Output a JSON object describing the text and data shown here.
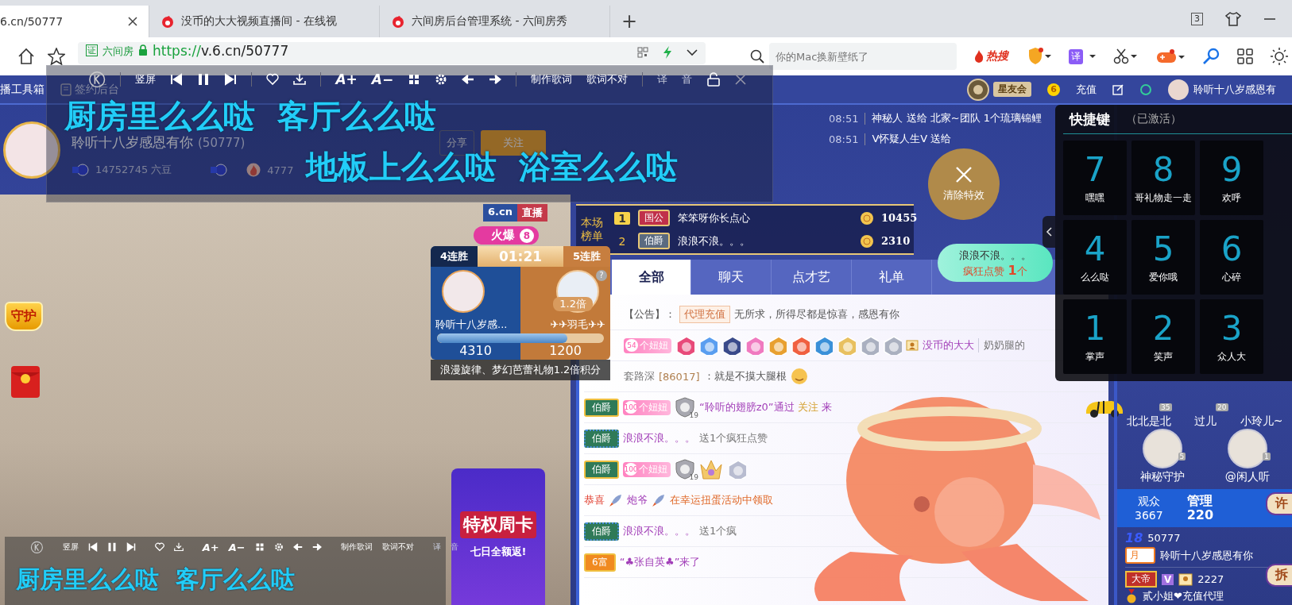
{
  "browser": {
    "tabs": [
      {
        "title": "6.cn/50777",
        "selected": true,
        "favicon": false
      },
      {
        "title": "没币的大大视频直播间 - 在线视",
        "selected": false,
        "favicon": true
      },
      {
        "title": "六间房后台管理系统 - 六间房秀",
        "selected": false,
        "favicon": true
      }
    ],
    "new_tab": "+",
    "tab_count": "3",
    "address": {
      "cert": "证",
      "site": "六间房",
      "scheme": "https://",
      "rest": "v.6.cn/50777"
    },
    "search": {
      "placeholder": "你的Mac换新壁纸了",
      "hot": "热搜"
    },
    "translate": "译"
  },
  "header": {
    "tools": [
      "播工具箱",
      "签约后台"
    ],
    "club": "星友会",
    "coin": "6",
    "recharge": "充值",
    "user": "聆听十八岁感恩有"
  },
  "streamer": {
    "name": "聆听十八岁感恩有你",
    "id": "(50777)",
    "beans": "14752745 六豆",
    "heat": "4777",
    "share": "分享",
    "follow": "关注"
  },
  "lyrics_window": {
    "rotate": "竖屏",
    "font_up": "A+",
    "font_down": "A−",
    "make": "制作歌词",
    "wrong": "歌词不对",
    "translate": "译",
    "sound": "音",
    "lines": [
      "厨房里么么哒  客厅么么哒",
      "地板上么么哒  浴室么么哒"
    ]
  },
  "gift_feed": [
    {
      "time": "08:51",
      "text": "神秘人 送给 北家~团队 1个琉璃锦鲤"
    },
    {
      "time": "08:51",
      "text": "V怀疑人生V 送给"
    }
  ],
  "video": {
    "site": "6.cn",
    "live": "直播",
    "hot": {
      "label": "火爆",
      "count": "8"
    },
    "guard": "守护",
    "promo": {
      "title": "特权周卡",
      "subtitle": "七日全额返!"
    },
    "lyrics_bar": {
      "rotate": "竖屏",
      "font_up": "A+",
      "font_down": "A−",
      "make": "制作歌词",
      "wrong": "歌词不对",
      "translate": "译",
      "sound": "音",
      "line": "厨房里么么哒  客厅么么哒"
    }
  },
  "pk": {
    "left_streak": "4连胜",
    "timer": "01:21",
    "right_streak": "5连胜",
    "help": "?",
    "multiplier": "1.2倍",
    "left_name": "聆听十八岁感...",
    "right_name": "✈✈羽毛✈✈",
    "level": 0.78,
    "left_score": "4310",
    "right_score": "1200",
    "note": "浪漫旋律、梦幻芭蕾礼物1.2倍积分"
  },
  "clear_effects": "清除特效",
  "ranking": {
    "title": "本场榜单",
    "rows": [
      {
        "rank": "1",
        "boxed": true,
        "title": "国公",
        "name": "笨笨呀你长点心",
        "score": "10455"
      },
      {
        "rank": "2",
        "boxed": false,
        "title": "伯爵",
        "name": "浪浪不浪。。。",
        "score": "2310"
      }
    ]
  },
  "like_bubble": {
    "name": "浪浪不浪。。。",
    "text": "疯狂点赞 **1**个"
  },
  "chat": {
    "tabs": [
      {
        "label": "全部",
        "selected": true
      },
      {
        "label": "聊天",
        "selected": false
      },
      {
        "label": "点才艺",
        "selected": false
      },
      {
        "label": "礼单",
        "selected": false
      }
    ],
    "messages": [
      {
        "kind": "notice",
        "label": "【公告】：",
        "tag": "代理充值",
        "text": "无所求，所得尽都是惊喜，感恩有你"
      },
      {
        "kind": "medals",
        "fan_level": "54",
        "fan_label": "个妞妞",
        "name": "没币的大大",
        "extra": "奶奶腿的"
      },
      {
        "kind": "chat",
        "name": "套路深",
        "uid": "[86017]",
        "text": "：就是不摸大腿根"
      },
      {
        "kind": "follow",
        "color": "#2f7a58",
        "dotted": false,
        "rank": "伯爵",
        "fan_level": "100",
        "fan_label": "个妞妞",
        "guard": "19",
        "before": "“聆听的翅膀z0”通过 ",
        "link": "关注",
        "after": " 来"
      },
      {
        "kind": "action",
        "color": "#2f7a58",
        "dotted": true,
        "rank": "伯爵",
        "name": "浪浪不浪。。。",
        "text": "送1个疯狂点赞"
      },
      {
        "kind": "welcome",
        "color": "#2f7a58",
        "dotted": false,
        "rank": "伯爵",
        "fan_level": "100",
        "fan_label": "个妞妞",
        "guard": "19"
      },
      {
        "kind": "system",
        "lead": "恭喜",
        "name": "炮爷",
        "text": "在幸运扭蛋活动中领取"
      },
      {
        "kind": "action",
        "color": "#2f7a58",
        "dotted": true,
        "rank": "伯爵",
        "name": "浪浪不浪。。。",
        "text": "送1个疯"
      },
      {
        "kind": "enter",
        "color": "#f08a20",
        "dotted": false,
        "rank": "6富",
        "text": "“♣张自英♣”来了"
      }
    ]
  },
  "shortcuts": {
    "title": "快捷键",
    "status": "（已激活）",
    "keys": [
      {
        "key": "7",
        "label": "嘿嘿"
      },
      {
        "key": "8",
        "label": "哥礼物走一走"
      },
      {
        "key": "9",
        "label": "欢呼"
      },
      {
        "key": "4",
        "label": "么么哒"
      },
      {
        "key": "5",
        "label": "爱你哦"
      },
      {
        "key": "6",
        "label": "心碎"
      },
      {
        "key": "1",
        "label": "掌声"
      },
      {
        "key": "2",
        "label": "笑声"
      },
      {
        "key": "3",
        "label": "众人大"
      }
    ]
  },
  "guards": {
    "rows": [
      {
        "show_avatars": false,
        "items": [
          {
            "name": "北北是北",
            "level": "35"
          },
          {
            "name": "过儿",
            "level": "20"
          },
          {
            "name": "小玲儿~"
          }
        ]
      },
      {
        "show_avatars": true,
        "items": [
          {
            "name": "神秘守护",
            "level": "5"
          },
          {
            "name": "@闲人听",
            "level": "1"
          }
        ]
      }
    ]
  },
  "stats": [
    {
      "label": "观众",
      "value": "3667",
      "selected": false
    },
    {
      "label": "管理",
      "value": "220",
      "selected": true
    }
  ],
  "side_buttons": [
    "许",
    "拆"
  ],
  "fans": [
    {
      "kind": "anchor",
      "level": "18",
      "number": "50777",
      "badge": "月",
      "name": "聆听十八岁感恩有你"
    },
    {
      "kind": "member",
      "badge": "大帝",
      "vip": "V",
      "number": "2227",
      "name": "贰小姐❤充值代理"
    }
  ]
}
